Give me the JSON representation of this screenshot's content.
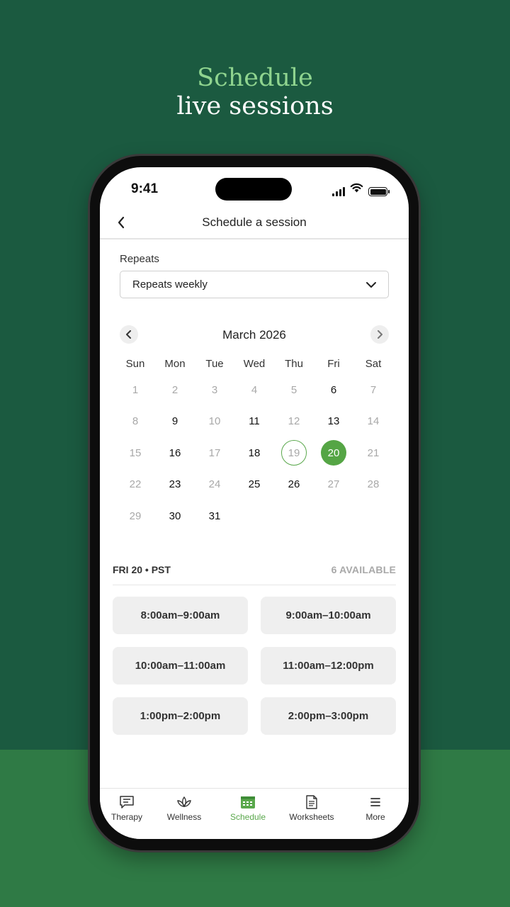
{
  "promo": {
    "line1": "Schedule",
    "line2": "live sessions"
  },
  "status_bar": {
    "time": "9:41"
  },
  "nav": {
    "title": "Schedule a session",
    "back_icon": "chevron-left-icon"
  },
  "repeats": {
    "label": "Repeats",
    "value": "Repeats weekly"
  },
  "calendar": {
    "month_label": "March 2026",
    "weekdays": [
      "Sun",
      "Mon",
      "Tue",
      "Wed",
      "Thu",
      "Fri",
      "Sat"
    ],
    "days": [
      {
        "label": "1",
        "available": false
      },
      {
        "label": "2",
        "available": false
      },
      {
        "label": "3",
        "available": false
      },
      {
        "label": "4",
        "available": false
      },
      {
        "label": "5",
        "available": false
      },
      {
        "label": "6",
        "available": true
      },
      {
        "label": "7",
        "available": false
      },
      {
        "label": "8",
        "available": false
      },
      {
        "label": "9",
        "available": true
      },
      {
        "label": "10",
        "available": false
      },
      {
        "label": "11",
        "available": true
      },
      {
        "label": "12",
        "available": false
      },
      {
        "label": "13",
        "available": true
      },
      {
        "label": "14",
        "available": false
      },
      {
        "label": "15",
        "available": false
      },
      {
        "label": "16",
        "available": true
      },
      {
        "label": "17",
        "available": false
      },
      {
        "label": "18",
        "available": true
      },
      {
        "label": "19",
        "available": false,
        "today": true
      },
      {
        "label": "20",
        "available": true,
        "selected": true
      },
      {
        "label": "21",
        "available": false
      },
      {
        "label": "22",
        "available": false
      },
      {
        "label": "23",
        "available": true
      },
      {
        "label": "24",
        "available": false
      },
      {
        "label": "25",
        "available": true
      },
      {
        "label": "26",
        "available": true
      },
      {
        "label": "27",
        "available": false
      },
      {
        "label": "28",
        "available": false
      },
      {
        "label": "29",
        "available": false
      },
      {
        "label": "30",
        "available": true
      },
      {
        "label": "31",
        "available": true
      }
    ]
  },
  "slots": {
    "date_label": "FRI 20 • PST",
    "available_label": "6 AVAILABLE",
    "times": [
      "8:00am–9:00am",
      "9:00am–10:00am",
      "10:00am–11:00am",
      "11:00am–12:00pm",
      "1:00pm–2:00pm",
      "2:00pm–3:00pm"
    ]
  },
  "tabbar": {
    "items": [
      {
        "label": "Therapy",
        "icon": "chat-bubble-icon",
        "active": false
      },
      {
        "label": "Wellness",
        "icon": "lotus-icon",
        "active": false
      },
      {
        "label": "Schedule",
        "icon": "calendar-icon",
        "active": true
      },
      {
        "label": "Worksheets",
        "icon": "document-icon",
        "active": false
      },
      {
        "label": "More",
        "icon": "menu-icon",
        "active": false
      }
    ]
  },
  "colors": {
    "background": "#1b5a40",
    "accent": "#55a545",
    "promo_highlight": "#8fd48f"
  }
}
